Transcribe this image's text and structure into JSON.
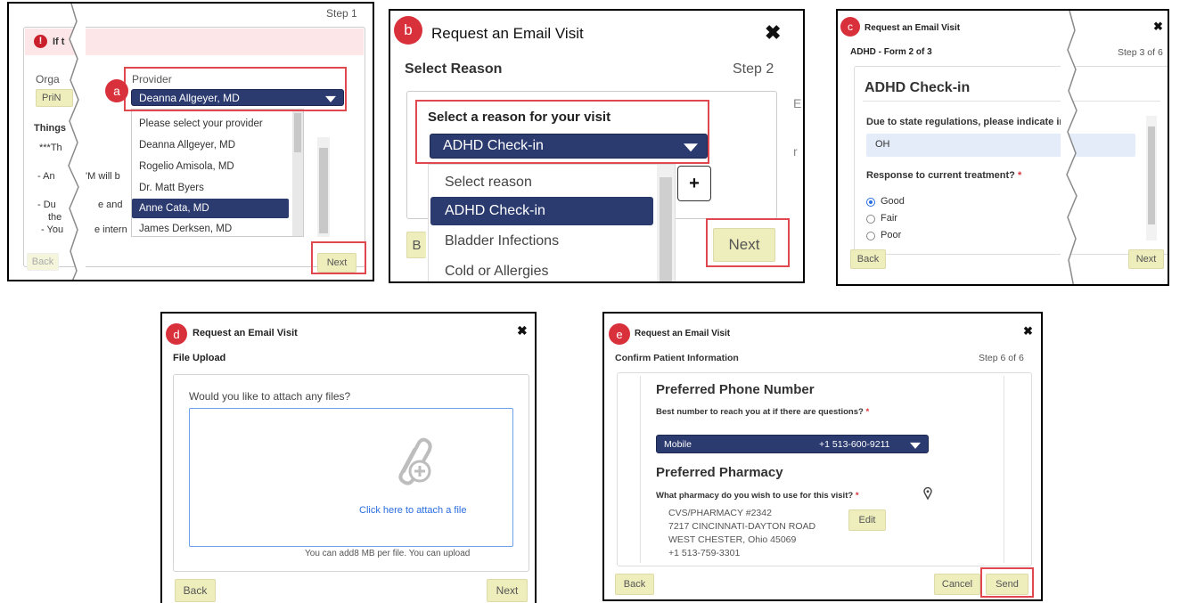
{
  "labels": {
    "a": "a",
    "b": "b",
    "c": "c",
    "d": "d",
    "e": "e"
  },
  "panel_a": {
    "step": "Step 1",
    "alert_text": "If t",
    "org_label": "Orga",
    "org_value": "PriN",
    "provider_label": "Provider",
    "provider_selected": "Deanna Allgeyer, MD",
    "things_label": "Things",
    "body_lines": [
      "***Th",
      "- An",
      "'M will b",
      "- Du",
      "e and",
      "the",
      "- You",
      "e intern",
      "a"
    ],
    "provider_options": [
      "Please select your provider",
      "Deanna Allgeyer, MD",
      "Rogelio Amisola, MD",
      "Dr. Matt Byers",
      "Anne Cata, MD",
      "James Derksen, MD"
    ],
    "selected_index": 4,
    "back": "Back",
    "next": "Next"
  },
  "panel_b": {
    "title": "Request an Email Visit",
    "section": "Select Reason",
    "step": "Step 2",
    "prompt": "Select a reason for your visit",
    "selected": "ADHD Check-in",
    "options": [
      "Select reason",
      "ADHD Check-in",
      "Bladder Infections",
      "Cold or Allergies"
    ],
    "selected_index": 1,
    "add_symbol": "+",
    "behind_text": "E",
    "behind_text2": "r",
    "back_partial": "B",
    "next": "Next"
  },
  "panel_c": {
    "title": "Request an Email Visit",
    "form": "ADHD - Form 2 of 3",
    "step": "Step 3 of 6",
    "heading": "ADHD Check-in",
    "regulation": "Due to state regulations, please indicate in",
    "state_value": "OH",
    "question": "Response to current treatment?",
    "required_mark": "*",
    "choices": [
      "Good",
      "Fair",
      "Poor"
    ],
    "selected_choice": 0,
    "back": "Back",
    "next": "Next"
  },
  "panel_d": {
    "title": "Request an Email Visit",
    "section": "File Upload",
    "question": "Would you like to attach any files?",
    "attach_link": "Click here to attach a file",
    "size_note": "You can add8 MB per file. You can upload",
    "back": "Back",
    "next": "Next"
  },
  "panel_e": {
    "title": "Request an Email Visit",
    "section": "Confirm Patient Information",
    "step": "Step 6 of 6",
    "phone_heading": "Preferred Phone Number",
    "phone_question": "Best number to reach you at if there are questions?",
    "required_mark": "*",
    "phone_type": "Mobile",
    "phone_number": "+1 513-600-9211",
    "pharmacy_heading": "Preferred Pharmacy",
    "pharmacy_question": "What pharmacy do you wish to use for this visit?",
    "pharmacy_lines": [
      "CVS/PHARMACY #2342",
      "7217 CINCINNATI-DAYTON ROAD",
      "WEST CHESTER, Ohio 45069",
      "+1 513-759-3301"
    ],
    "edit": "Edit",
    "back": "Back",
    "cancel": "Cancel",
    "send": "Send"
  },
  "colors": {
    "navy": "#2b3a6f",
    "callout": "#d9313c",
    "highlight": "#e0474f",
    "beige_button": "#eeeebd",
    "link_blue": "#2a6de0"
  }
}
